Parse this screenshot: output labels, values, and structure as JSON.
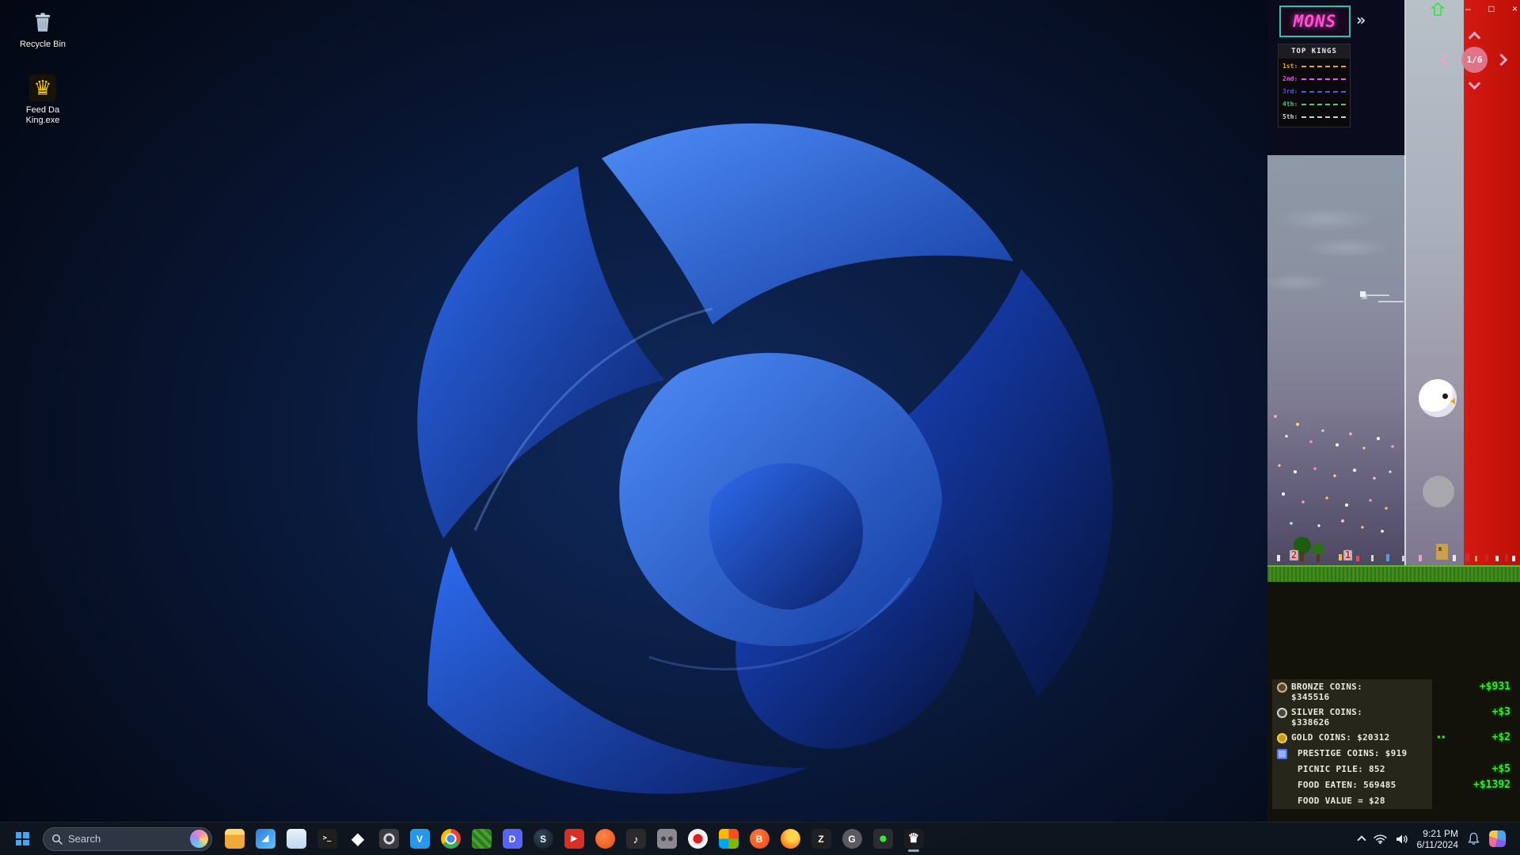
{
  "desktop": {
    "icons": [
      {
        "label": "Recycle Bin"
      },
      {
        "label": "Feed Da King.exe",
        "glyph": "♛"
      }
    ]
  },
  "game": {
    "logo": "MONS",
    "logo_more": "»",
    "controls": {
      "minimize": "–",
      "maximize": "□",
      "close": "×"
    },
    "pager": "1/6",
    "top_kings": {
      "title": "TOP KINGS",
      "entries": [
        {
          "rank": "1st:",
          "color": "#f0a335"
        },
        {
          "rank": "2nd:",
          "color": "#ee55ee"
        },
        {
          "rank": "3rd:",
          "color": "#4a5ae8"
        },
        {
          "rank": "4th:",
          "color": "#4ec87a"
        },
        {
          "rank": "5th:",
          "color": "#cfcfcf"
        }
      ]
    },
    "markers": [
      {
        "num": "2"
      },
      {
        "num": "1"
      }
    ],
    "stats": [
      {
        "icon": "bronze",
        "label": "BRONZE COINS:",
        "value": "$345516",
        "mid": "",
        "delta": "+$931"
      },
      {
        "icon": "silver",
        "label": "SILVER COINS:",
        "value": "$338626",
        "mid": "",
        "delta": "+$3"
      },
      {
        "icon": "gold",
        "label": "GOLD COINS: $20312",
        "value": "",
        "mid": "▪▪",
        "delta": "+$2"
      },
      {
        "icon": "prestige",
        "label": "PRESTIGE COINS: $919",
        "value": "",
        "mid": "",
        "delta": ""
      },
      {
        "icon": "",
        "label": "PICNIC PILE: 852",
        "value": "",
        "mid": "",
        "delta": "+$5"
      },
      {
        "icon": "",
        "label": "FOOD EATEN: 569485",
        "value": "",
        "mid": "",
        "delta": "+$1392"
      },
      {
        "icon": "",
        "label": "FOOD VALUE = $28",
        "value": "",
        "mid": "",
        "delta": ""
      }
    ]
  },
  "taskbar": {
    "search": {
      "placeholder": "Search"
    },
    "apps": [
      {
        "name": "file-explorer",
        "glyph": "",
        "bg": "linear-gradient(180deg,#ffd773 0 30%,#f0a83a 30%)",
        "fg": "#fff"
      },
      {
        "name": "photos",
        "glyph": "◢",
        "bg": "linear-gradient(135deg,#2a7de0,#62c3f5)",
        "fg": "#ffffff"
      },
      {
        "name": "store",
        "glyph": "",
        "bg": "linear-gradient(180deg,#e8f2fa,#bcd8f0)",
        "fg": "#2a7de0"
      },
      {
        "name": "terminal",
        "glyph": ">_",
        "bg": "#1e1e1e",
        "fg": "#e8e8e8"
      },
      {
        "name": "red-diamond",
        "glyph": "◆",
        "bg": "transparent",
        "fg": "#e02828"
      },
      {
        "name": "settings",
        "glyph": "",
        "bg": "radial-gradient(circle, rgba(0,0,0,0) 0 4px, #d8d8d8 4px 7px, rgba(0,0,0,0) 7px), #3c3c40",
        "fg": "#d8d8d8"
      },
      {
        "name": "vscode",
        "glyph": "V",
        "bg": "#2798e8",
        "fg": "#ffffff"
      },
      {
        "name": "chrome",
        "glyph": "",
        "bg": "radial-gradient(circle at 50% 50%, #4285f4 0 5px, #ffffff 5px 7px, rgba(0,0,0,0) 7px), conic-gradient(#ea4335 0 33%, #34a853 33% 66%, #fbbc05 66% 100%)",
        "fg": "#fff"
      },
      {
        "name": "pixel-game",
        "glyph": "",
        "bg": "repeating-linear-gradient(45deg,#46a32e 0 4px,#2f7a1e 4px 8px)",
        "fg": "#fff"
      },
      {
        "name": "discord",
        "glyph": "D",
        "bg": "#5865f2",
        "fg": "#ffffff"
      },
      {
        "name": "steam",
        "glyph": "S",
        "bg": "radial-gradient(circle at 35% 30%,#2a475e,#171a21)",
        "fg": "#ffffff"
      },
      {
        "name": "media-red",
        "glyph": "▶",
        "bg": "#d93025",
        "fg": "#ffffff"
      },
      {
        "name": "orange-circle",
        "glyph": "",
        "bg": "radial-gradient(circle at 40% 35%,#ff8a4a,#e84a10)",
        "fg": "#fff"
      },
      {
        "name": "music",
        "glyph": "♪",
        "bg": "#2a2a2e",
        "fg": "#f0a030"
      },
      {
        "name": "gray-controller",
        "glyph": "",
        "bg": "radial-gradient(circle at 32% 50%, #3f3f44 0 3px, rgba(0,0,0,0) 3px), radial-gradient(circle at 68% 50%, #3f3f44 0 3px, rgba(0,0,0,0) 3px), #8a8a90",
        "fg": "#fff"
      },
      {
        "name": "red-white-dot",
        "glyph": "",
        "bg": "radial-gradient(circle,#e02020 0 6px,#f2f2f2 6px)",
        "fg": "#fff"
      },
      {
        "name": "office-grid",
        "glyph": "",
        "bg": "conic-gradient(#f25022 0 25%,#7fba00 25% 50%,#00a4ef 50% 75%,#ffb900 75%)",
        "fg": "#fff"
      },
      {
        "name": "brave",
        "glyph": "B",
        "bg": "radial-gradient(circle at 40% 35%,#ff7a3a,#e8481c)",
        "fg": "#ffffff"
      },
      {
        "name": "firefox",
        "glyph": "",
        "bg": "radial-gradient(circle at 60% 35%,#ffd54a 0 30%,#ff9a2a 55%,#e8481c)",
        "fg": "#fff"
      },
      {
        "name": "z-app",
        "glyph": "Z",
        "bg": "#202024",
        "fg": "#f0f0f0"
      },
      {
        "name": "g-app",
        "glyph": "G",
        "bg": "#5a5a60",
        "fg": "#ffffff"
      },
      {
        "name": "dark-controller",
        "glyph": "",
        "bg": "radial-gradient(circle at 50% 50%, #35e83a 0 4px, rgba(0,0,0,0) 4px), #2c2c30",
        "fg": "#fff"
      },
      {
        "name": "feed-da-king",
        "glyph": "♛",
        "bg": "#1c1c20",
        "fg": "#f5c518",
        "active": true
      }
    ],
    "tray": {
      "time": "9:21 PM",
      "date": "6/11/2024"
    }
  }
}
